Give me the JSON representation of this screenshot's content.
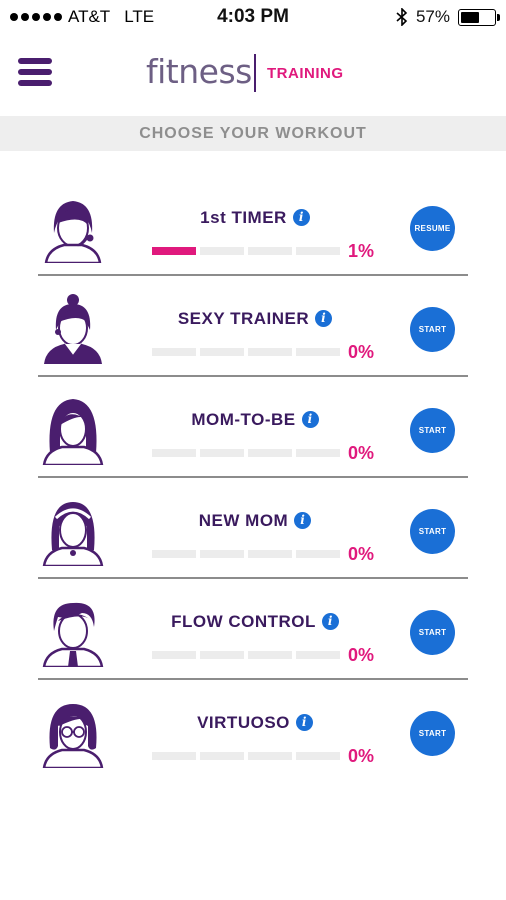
{
  "status_bar": {
    "carrier": "AT&T",
    "network": "LTE",
    "time": "4:03 PM",
    "battery_text": "57%",
    "battery_level": 0.57,
    "bluetooth_icon": "bluetooth-icon"
  },
  "header": {
    "brand": "fitness",
    "section": "TRAINING",
    "menu_icon": "hamburger-menu-icon"
  },
  "banner": {
    "title": "CHOOSE YOUR WORKOUT"
  },
  "colors": {
    "accent_pink": "#e0197d",
    "button_blue": "#1a6fd6",
    "brand_purple": "#4a1e6e"
  },
  "workouts": [
    {
      "title": "1st TIMER",
      "percent_text": "1%",
      "progress": 0.25,
      "button": "RESUME",
      "avatar": "avatar-headset-icon"
    },
    {
      "title": "SEXY TRAINER",
      "percent_text": "0%",
      "progress": 0,
      "button": "START",
      "avatar": "avatar-bun-headset-icon"
    },
    {
      "title": "MOM-TO-BE",
      "percent_text": "0%",
      "progress": 0,
      "button": "START",
      "avatar": "avatar-long-hair-icon"
    },
    {
      "title": "NEW MOM",
      "percent_text": "0%",
      "progress": 0,
      "button": "START",
      "avatar": "avatar-headband-icon"
    },
    {
      "title": "FLOW CONTROL",
      "percent_text": "0%",
      "progress": 0,
      "button": "START",
      "avatar": "avatar-short-hair-tie-icon"
    },
    {
      "title": "VIRTUOSO",
      "percent_text": "0%",
      "progress": 0,
      "button": "START",
      "avatar": "avatar-glasses-icon"
    }
  ]
}
